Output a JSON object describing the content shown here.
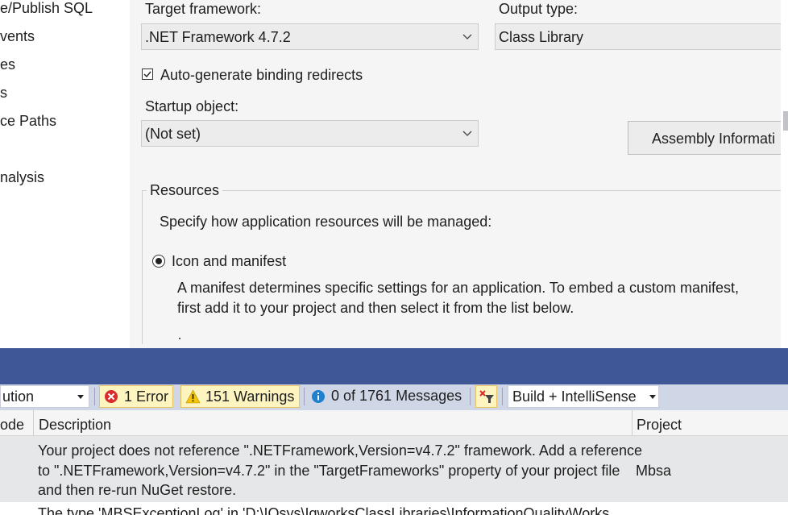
{
  "left_nav": {
    "items": [
      "e/Publish SQL",
      "vents",
      "es",
      "s",
      "ce Paths",
      "nalysis"
    ]
  },
  "properties": {
    "target_framework_label": "Target framework:",
    "target_framework_value": ".NET Framework 4.7.2",
    "output_type_label": "Output type:",
    "output_type_value": "Class Library",
    "auto_binding_label": "Auto-generate binding redirects",
    "auto_binding_checked": true,
    "startup_object_label": "Startup object:",
    "startup_object_value": "(Not set)",
    "assembly_info_button": "Assembly Informati",
    "resources_group_label": "Resources",
    "resources_description": "Specify how application resources will be managed:",
    "icon_manifest_option": "Icon and manifest",
    "manifest_description_line1": "A manifest determines specific settings for an application. To embed a custom manifest,",
    "manifest_description_line2": "first add it to your project and then select it from the list below."
  },
  "error_list": {
    "scope_value": "ution",
    "errors_label": "1 Error",
    "warnings_label": "151 Warnings",
    "messages_label": "0 of 1761 Messages",
    "build_filter_value": "Build + IntelliSense",
    "columns": {
      "code": "ode",
      "description": "Description",
      "project": "Project"
    },
    "rows": [
      {
        "description_line1": "Your project does not reference \".NETFramework,Version=v4.7.2\" framework. Add a reference",
        "description_line2": "to \".NETFramework,Version=v4.7.2\" in the \"TargetFrameworks\" property of your project file",
        "description_line3": "and then re-run NuGet restore.",
        "project": "Mbsa"
      },
      {
        "description_line1": "The type 'MBSExceptionLog' in 'D:\\IQsys\\IqworksClassLibraries\\InformationQualityWorks"
      }
    ]
  },
  "colors": {
    "error_list_title": "#3f5797",
    "toolbar_bg": "#cfd6e5",
    "filter_active_bg": "#fdf4bf",
    "filter_active_border": "#e5c365",
    "error_red": "#d92b2b",
    "warning_yellow": "#f6c600",
    "info_blue": "#1f80d0"
  }
}
